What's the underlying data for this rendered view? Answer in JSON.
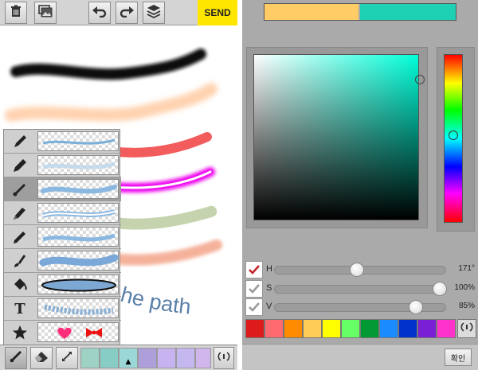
{
  "toolbar": {
    "send_label": "SEND",
    "icons": [
      "trash-icon",
      "gallery-icon",
      "undo-icon",
      "redo-icon",
      "layers-icon"
    ]
  },
  "canvas": {
    "text_path_label": "he path"
  },
  "brush_popup": {
    "selected_index": 2,
    "items": [
      {
        "icon": "pen-icon"
      },
      {
        "icon": "marker-icon"
      },
      {
        "icon": "brush-icon"
      },
      {
        "icon": "highlighter-icon"
      },
      {
        "icon": "pencil-icon"
      },
      {
        "icon": "paint-brush-icon"
      },
      {
        "icon": "paint-bucket-icon"
      },
      {
        "icon": "text-icon",
        "label": "T"
      },
      {
        "icon": "star-stamp-icon"
      }
    ]
  },
  "bottom_bar": {
    "current_swatch_symbol": "▲",
    "swatches": [
      "#9ed2c5",
      "#88cdc5",
      "#9ad7d6",
      "#ad9fd9",
      "#c6b3f0",
      "#c5b7f0",
      "#d0b6ea"
    ]
  },
  "color_picker": {
    "previous_color": "#ffcc66",
    "current_color": "#1ed1b4",
    "hue": {
      "label": "H",
      "value": "171°",
      "checked": true,
      "fraction": 0.475
    },
    "saturation": {
      "label": "S",
      "value": "100%",
      "checked": false,
      "fraction": 1.0
    },
    "value": {
      "label": "V",
      "value": "85%",
      "checked": false,
      "fraction": 0.85
    },
    "palette": [
      "#dd1b1b",
      "#ff6a70",
      "#ff8c00",
      "#ffcc55",
      "#ffff00",
      "#66ff66",
      "#009933",
      "#1a8cff",
      "#0033cc",
      "#7a1fd6",
      "#ff33cc"
    ],
    "confirm_label": "확인"
  }
}
